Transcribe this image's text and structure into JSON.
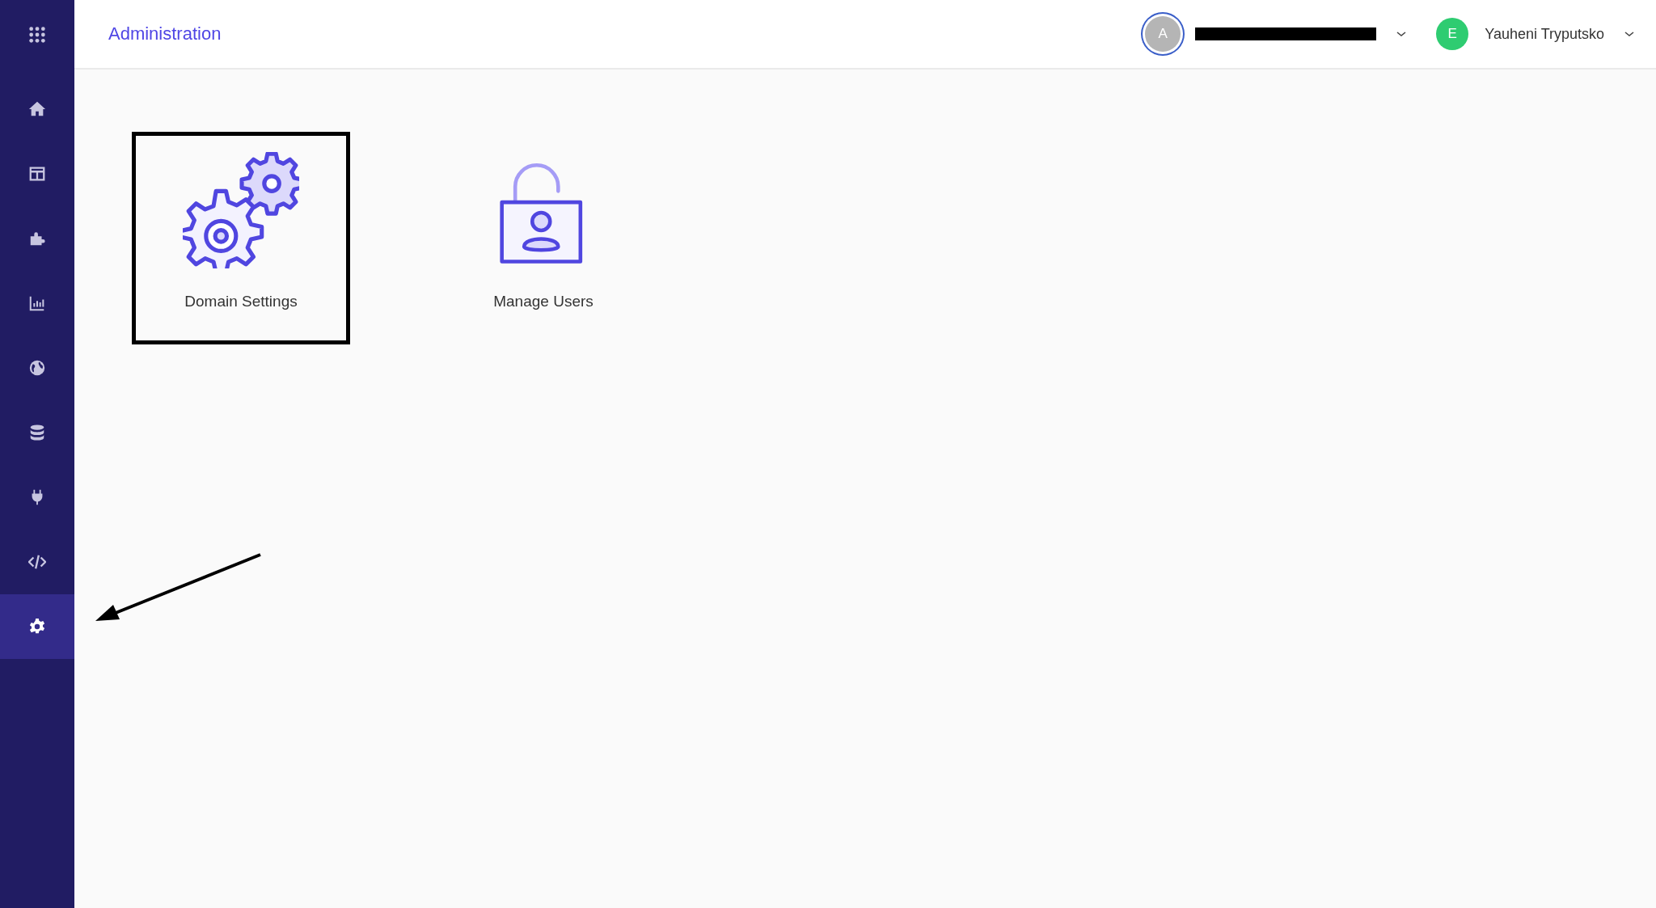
{
  "sidebar": {
    "items": [
      {
        "kind": "apps",
        "selected": false
      },
      {
        "kind": "home",
        "selected": false
      },
      {
        "kind": "layout",
        "selected": false
      },
      {
        "kind": "puzzle",
        "selected": false
      },
      {
        "kind": "chart",
        "selected": false
      },
      {
        "kind": "globe",
        "selected": false
      },
      {
        "kind": "database",
        "selected": false
      },
      {
        "kind": "plug",
        "selected": false
      },
      {
        "kind": "code",
        "selected": false
      },
      {
        "kind": "gear",
        "selected": true
      }
    ]
  },
  "header": {
    "title": "Administration",
    "accounts": [
      {
        "initial": "A",
        "color": "#b5b5b5",
        "ringed": true,
        "name_redacted": true
      },
      {
        "initial": "E",
        "color": "#2ecc71",
        "ringed": false,
        "name": "Yauheni Tryputsko"
      }
    ]
  },
  "tiles": [
    {
      "kind": "gears",
      "label": "Domain Settings",
      "outlined": true
    },
    {
      "kind": "user-lock",
      "label": "Manage Users",
      "outlined": false
    }
  ]
}
